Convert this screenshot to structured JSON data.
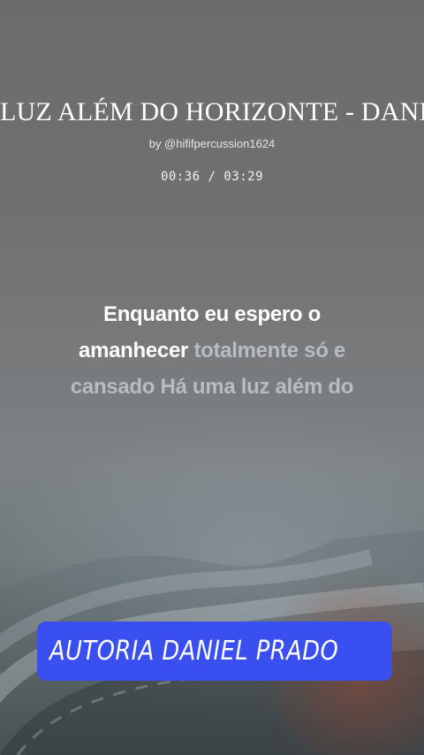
{
  "video": {
    "title": "LUZ ALÉM DO HORIZONTE - DANIEL PRADO",
    "byline": "by @hififpercussion1624",
    "time": {
      "current": "00:36",
      "separator": "/",
      "total": "03:29",
      "display": "00:36 / 03:29"
    }
  },
  "lyrics": {
    "line1": {
      "sung": "Enquanto eu espero o",
      "unsung": ""
    },
    "line2": {
      "sung": "amanhecer",
      "unsung": "totalmente só e"
    },
    "line3": {
      "sung": "",
      "unsung": "cansado Há uma luz além do"
    }
  },
  "credit": {
    "label": "AUTORIA DANIEL PRADO"
  },
  "colors": {
    "background": "#707173",
    "sung_text": "#ffffff",
    "unsung_text": "#b9bcbe",
    "credit_box": "#3a4ff0"
  }
}
